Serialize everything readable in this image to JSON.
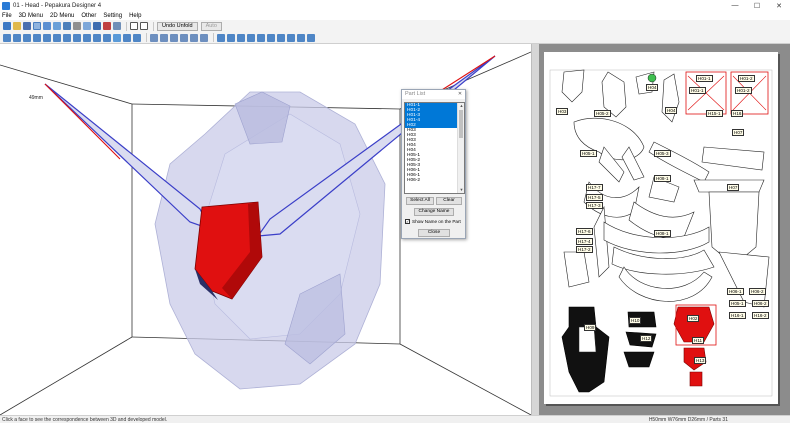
{
  "window": {
    "title": "01 - Head - Pepakura Designer 4",
    "minimize": "—",
    "maximize": "☐",
    "close": "✕"
  },
  "menu": [
    "File",
    "3D Menu",
    "2D Menu",
    "Other",
    "Setting",
    "Help"
  ],
  "toolbar": {
    "undo_unfold": "Undo Unfold",
    "auto": "Auto"
  },
  "view3d": {
    "dimension_label": "49mm"
  },
  "part_list": {
    "title": "Part List",
    "close": "✕",
    "items": [
      {
        "label": "H01-1",
        "selected": true
      },
      {
        "label": "H01-2",
        "selected": true
      },
      {
        "label": "H01-3",
        "selected": true
      },
      {
        "label": "H01-4",
        "selected": true
      },
      {
        "label": "H02",
        "selected": true
      },
      {
        "label": "H03",
        "selected": false
      },
      {
        "label": "H03",
        "selected": false
      },
      {
        "label": "H03",
        "selected": false
      },
      {
        "label": "H04",
        "selected": false
      },
      {
        "label": "H04",
        "selected": false
      },
      {
        "label": "H05-1",
        "selected": false
      },
      {
        "label": "H05-2",
        "selected": false
      },
      {
        "label": "H05-3",
        "selected": false
      },
      {
        "label": "H06-1",
        "selected": false
      },
      {
        "label": "H06-1",
        "selected": false
      },
      {
        "label": "H06-2",
        "selected": false
      }
    ],
    "scroll_up": "▲",
    "scroll_down": "▼",
    "select_all": "Select All",
    "clear": "Clear",
    "change_name": "Change Name",
    "show_name_on_part": "Show Name on the Part",
    "show_name_checked": "✓",
    "close_button": "Close"
  },
  "layout2d": {
    "labels": [
      "H01-1",
      "H01-2",
      "H01-1",
      "H01-2",
      "H04",
      "H03",
      "H04",
      "H05-2",
      "H15-1",
      "H16",
      "H07",
      "H05-1",
      "H05-3",
      "H08-1",
      "H17-7",
      "H17-5",
      "H17-3",
      "H07",
      "H08-1",
      "H17-6",
      "H17-4",
      "H17-2",
      "H10",
      "H09",
      "H12",
      "H02",
      "H11",
      "H13",
      "H06-1",
      "H06-2",
      "H05-1",
      "H06-2",
      "H16-1",
      "H16-2"
    ]
  },
  "status": {
    "left": "Click a face to see the correspondence between 3D and developed model.",
    "right": "H50mm W76mm D26mm / Parts 31"
  },
  "colors": {
    "accent_red": "#e01010",
    "mesh_fill": "#c9cbe8",
    "selection_blue": "#0078d7",
    "edge_blue": "#3b3fc8"
  }
}
